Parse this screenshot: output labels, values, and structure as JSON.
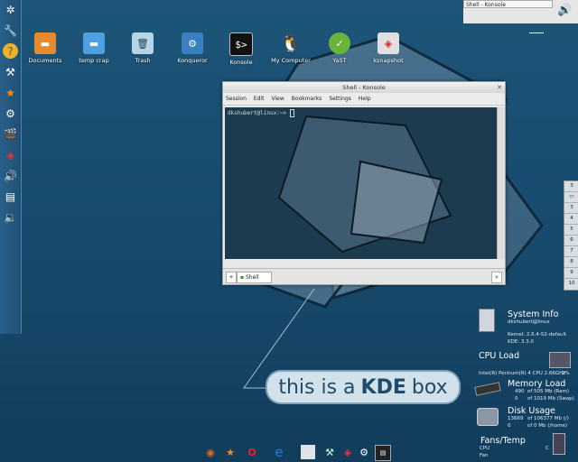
{
  "desktop_icons": [
    {
      "label": "Documents",
      "icon": "folder-documents-icon"
    },
    {
      "label": "temp crap",
      "icon": "folder-icon"
    },
    {
      "label": "Trash",
      "icon": "trash-icon"
    },
    {
      "label": "Konqueror",
      "icon": "konqueror-icon"
    },
    {
      "label": "Konsole",
      "icon": "konsole-icon"
    },
    {
      "label": "My Computer",
      "icon": "tux-icon"
    },
    {
      "label": "YaST",
      "icon": "yast-icon"
    },
    {
      "label": "ksnapshot",
      "icon": "ksnapshot-icon"
    }
  ],
  "konsole": {
    "title": "Shell - Konsole",
    "menu": [
      "Session",
      "Edit",
      "View",
      "Bookmarks",
      "Settings",
      "Help"
    ],
    "prompt": "dkshubert@linux:~> ",
    "tab_label": "Shell"
  },
  "taskbar": {
    "task_label": "Shell - Konsole"
  },
  "pager": [
    "3",
    "",
    "3",
    "4",
    "5",
    "6",
    "7",
    "8",
    "9",
    "10"
  ],
  "banner": {
    "pre": "this is a",
    "bold": "KDE",
    "post": "box"
  },
  "system_info": {
    "title": "System Info",
    "user": "dkshubert@linux",
    "kernel": "Kernel: 2.6.4-52-default",
    "kde": "KDE: 3.3.0"
  },
  "cpu": {
    "title": "CPU Load",
    "model": "Intel(R) Pentium(R) 4 CPU 2.66GHz",
    "percent": "2%"
  },
  "memory": {
    "title": "Memory Load",
    "ram_used": "490",
    "ram_text": "of 505 Mb (Ram)",
    "swap_used": "0",
    "swap_text": "of 1019 Mb (Swap)"
  },
  "disk": {
    "title": "Disk Usage",
    "root_used": "13669",
    "root_text": "of 106377 Mb (/)",
    "home_used": "0",
    "home_text": "of 0 Mb (/home)"
  },
  "fans": {
    "title": "Fans/Temp",
    "cpu_label": "CPU",
    "fan_label": "Fan",
    "unit": "C"
  },
  "colors": {
    "desktop": "#17496c",
    "panel": "#1f4f73",
    "terminal_bg": "#1c3b4e"
  }
}
